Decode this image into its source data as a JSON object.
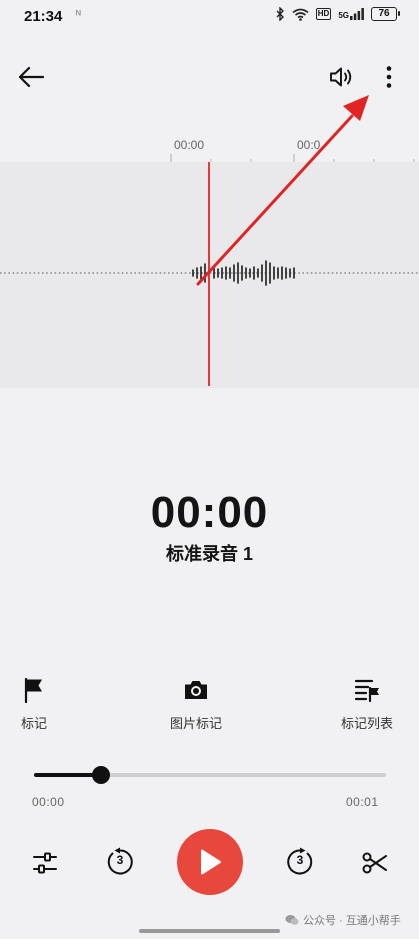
{
  "status_bar": {
    "time": "21:34",
    "notification": "ᴺ",
    "hd_label": "HD",
    "signal_label": "5G",
    "battery_level": "76"
  },
  "timeline": {
    "tick_labels": [
      "00:00",
      "00:0"
    ]
  },
  "recording": {
    "elapsed": "00:00",
    "name": "标准录音 1"
  },
  "tools": {
    "mark_label": "标记",
    "photo_mark_label": "图片标记",
    "mark_list_label": "标记列表"
  },
  "progress": {
    "current": "00:00",
    "total": "00:01",
    "fraction": 0.19
  },
  "controls": {
    "rewind_seconds": "3",
    "forward_seconds": "3"
  },
  "watermark": {
    "text": "公众号 · 互通小帮手"
  },
  "colors": {
    "accent": "#e8473b",
    "playhead": "#e53935",
    "arrow": "#e02424",
    "background": "#f1f1f3"
  }
}
